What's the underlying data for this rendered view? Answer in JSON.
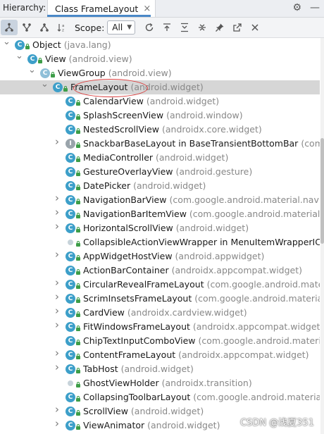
{
  "header": {
    "label": "Hierarchy:",
    "tab_title": "Class FrameLayout",
    "tab_close": "×",
    "icons": [
      "settings-icon",
      "minimize-icon"
    ]
  },
  "toolbar": {
    "scope_label": "Scope:",
    "scope_value": "All",
    "buttons": [
      "type-hierarchy-icon",
      "supertypes-icon",
      "subtypes-icon",
      "sort-alpha-icon",
      "refresh-icon",
      "export-icon",
      "expand-all-icon",
      "collapse-all-icon",
      "pin-icon",
      "open-in-editor-icon",
      "close-icon"
    ]
  },
  "tree": [
    {
      "level": 0,
      "chevron": "down",
      "icon": "class",
      "name": "Object",
      "pkg": "(java.lang)"
    },
    {
      "level": 1,
      "chevron": "down",
      "icon": "class",
      "name": "View",
      "pkg": "(android.view)"
    },
    {
      "level": 2,
      "chevron": "down",
      "icon": "abstract",
      "name": "ViewGroup",
      "pkg": "(android.view)"
    },
    {
      "level": 3,
      "chevron": "down",
      "icon": "class",
      "name": "FrameLayout",
      "pkg": "(android.widget)",
      "selected": true
    },
    {
      "level": 4,
      "chevron": "",
      "icon": "class",
      "name": "CalendarView",
      "pkg": "(android.widget)"
    },
    {
      "level": 4,
      "chevron": "",
      "icon": "class",
      "name": "SplashScreenView",
      "pkg": "(android.window)"
    },
    {
      "level": 4,
      "chevron": "",
      "icon": "class",
      "name": "NestedScrollView",
      "pkg": "(androidx.core.widget)"
    },
    {
      "level": 4,
      "chevron": "right",
      "icon": "interface",
      "name": "SnackbarBaseLayout in BaseTransientBottomBar",
      "pkg": "(com.g"
    },
    {
      "level": 4,
      "chevron": "",
      "icon": "class",
      "name": "MediaController",
      "pkg": "(android.widget)"
    },
    {
      "level": 4,
      "chevron": "",
      "icon": "class",
      "name": "GestureOverlayView",
      "pkg": "(android.gesture)"
    },
    {
      "level": 4,
      "chevron": "",
      "icon": "class",
      "name": "DatePicker",
      "pkg": "(android.widget)"
    },
    {
      "level": 4,
      "chevron": "right",
      "icon": "class",
      "name": "NavigationBarView",
      "pkg": "(com.google.android.material.navig"
    },
    {
      "level": 4,
      "chevron": "right",
      "icon": "class",
      "name": "NavigationBarItemView",
      "pkg": "(com.google.android.material.n"
    },
    {
      "level": 4,
      "chevron": "right",
      "icon": "class",
      "name": "HorizontalScrollView",
      "pkg": "(android.widget)"
    },
    {
      "level": 4,
      "chevron": "",
      "icon": "dot",
      "name": "CollapsibleActionViewWrapper in MenuItemWrapperICS",
      "pkg": ""
    },
    {
      "level": 4,
      "chevron": "right",
      "icon": "class",
      "name": "AppWidgetHostView",
      "pkg": "(android.appwidget)"
    },
    {
      "level": 4,
      "chevron": "",
      "icon": "class",
      "name": "ActionBarContainer",
      "pkg": "(androidx.appcompat.widget)"
    },
    {
      "level": 4,
      "chevron": "right",
      "icon": "class",
      "name": "CircularRevealFrameLayout",
      "pkg": "(com.google.android.materi"
    },
    {
      "level": 4,
      "chevron": "right",
      "icon": "class",
      "name": "ScrimInsetsFrameLayout",
      "pkg": "(com.google.android.material.i"
    },
    {
      "level": 4,
      "chevron": "right",
      "icon": "class",
      "name": "CardView",
      "pkg": "(androidx.cardview.widget)"
    },
    {
      "level": 4,
      "chevron": "right",
      "icon": "class",
      "name": "FitWindowsFrameLayout",
      "pkg": "(androidx.appcompat.widget)"
    },
    {
      "level": 4,
      "chevron": "",
      "icon": "class",
      "name": "ChipTextInputComboView",
      "pkg": "(com.google.android.materia"
    },
    {
      "level": 4,
      "chevron": "right",
      "icon": "class",
      "name": "ContentFrameLayout",
      "pkg": "(androidx.appcompat.widget)"
    },
    {
      "level": 4,
      "chevron": "right",
      "icon": "class",
      "name": "TabHost",
      "pkg": "(android.widget)"
    },
    {
      "level": 4,
      "chevron": "",
      "icon": "dot",
      "name": "GhostViewHolder",
      "pkg": "(androidx.transition)"
    },
    {
      "level": 4,
      "chevron": "",
      "icon": "class",
      "name": "CollapsingToolbarLayout",
      "pkg": "(com.google.android.material.a"
    },
    {
      "level": 4,
      "chevron": "right",
      "icon": "class",
      "name": "ScrollView",
      "pkg": "(android.widget)"
    },
    {
      "level": 4,
      "chevron": "right",
      "icon": "class",
      "name": "ViewAnimator",
      "pkg": "(android.widget)"
    }
  ],
  "watermark": "CSDN @浅夏351",
  "colors": {
    "class_icon": "#3d9fc9",
    "selection": "#d6d6d6",
    "highlight_oval": "#d93b3b",
    "tab_underline": "#4a88c7"
  }
}
